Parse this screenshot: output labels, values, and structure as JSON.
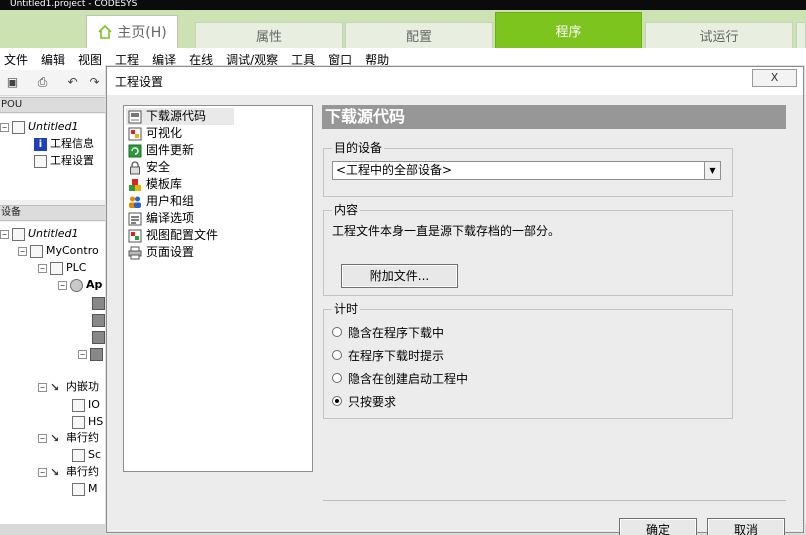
{
  "window": {
    "title": "Untitled1.project - CODESYS"
  },
  "ribbon": {
    "home_label": "主页(H)",
    "tabs": [
      {
        "label": "属性"
      },
      {
        "label": "配置"
      },
      {
        "label": "程序",
        "active": true
      },
      {
        "label": "试运行"
      }
    ],
    "accent": "#7ec41f"
  },
  "menu": [
    "文件",
    "编辑",
    "视图",
    "工程",
    "编译",
    "在线",
    "调试/观察",
    "工具",
    "窗口",
    "帮助"
  ],
  "pou_panel": {
    "header": "POU",
    "items": [
      {
        "label": "Untitled1",
        "italic": true
      },
      {
        "label": "工程信息",
        "icon": "info-icon"
      },
      {
        "label": "工程设置",
        "icon": "settings-icon"
      }
    ]
  },
  "devices_panel": {
    "header": "设备",
    "items": [
      {
        "label": "Untitled1",
        "italic": true
      },
      {
        "label": "MyContro"
      },
      {
        "label": "PLC"
      },
      {
        "label": "Ap"
      },
      {
        "label": "内嵌功"
      },
      {
        "label": "IO"
      },
      {
        "label": "HS"
      },
      {
        "label": "串行约"
      },
      {
        "label": "Sc"
      },
      {
        "label": "串行约"
      },
      {
        "label": "M"
      }
    ]
  },
  "dialog": {
    "title": "工程设置",
    "close_label": "X",
    "nav": [
      {
        "label": "下载源代码",
        "icon": "download-source-icon",
        "selected": true
      },
      {
        "label": "可视化",
        "icon": "visualization-icon"
      },
      {
        "label": "固件更新",
        "icon": "firmware-update-icon"
      },
      {
        "label": "安全",
        "icon": "security-lock-icon"
      },
      {
        "label": "模板库",
        "icon": "template-library-icon"
      },
      {
        "label": "用户和组",
        "icon": "users-groups-icon"
      },
      {
        "label": "编译选项",
        "icon": "compile-options-icon"
      },
      {
        "label": "视图配置文件",
        "icon": "view-profile-icon"
      },
      {
        "label": "页面设置",
        "icon": "page-setup-printer-icon"
      }
    ],
    "content_title": "下载源代码",
    "target": {
      "legend": "目的设备",
      "value": "<工程中的全部设备>"
    },
    "contents": {
      "legend": "内容",
      "text": "工程文件本身一直是源下载存档的一部分。",
      "attach_button": "附加文件..."
    },
    "timing": {
      "legend": "计时",
      "options": [
        {
          "label": "隐含在程序下载中",
          "checked": false
        },
        {
          "label": "在程序下载时提示",
          "checked": false
        },
        {
          "label": "隐含在创建启动工程中",
          "checked": false
        },
        {
          "label": "只按要求",
          "checked": true
        }
      ]
    },
    "ok_label": "确定",
    "cancel_label": "取消"
  }
}
